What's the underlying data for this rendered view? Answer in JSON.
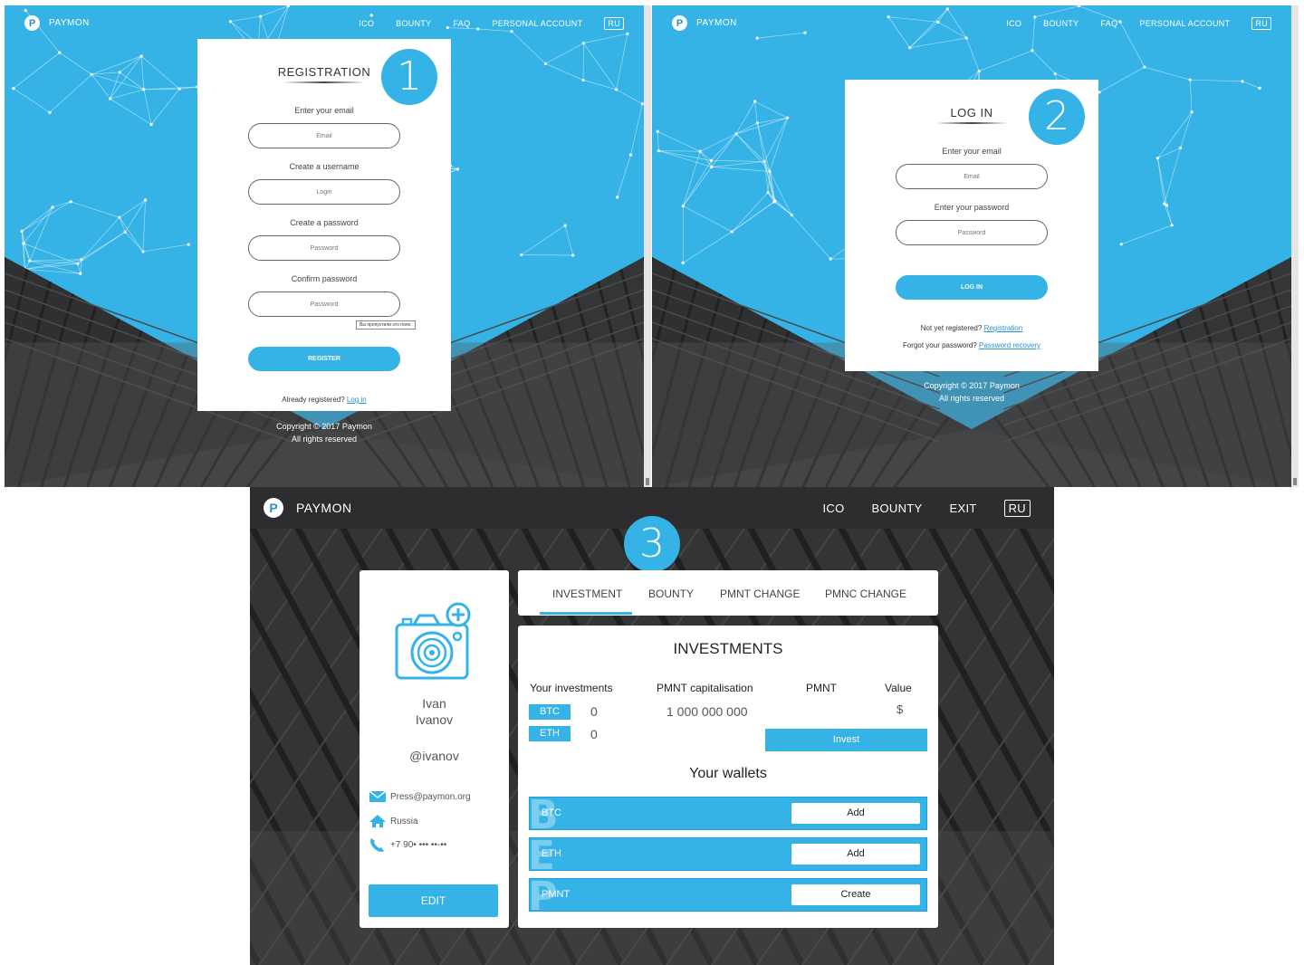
{
  "colors": {
    "accent": "#35b3e6",
    "dark": "#2d2d2f",
    "link": "#2b91d6"
  },
  "nav": {
    "brand": "PAYMON",
    "ico": "ICO",
    "bounty": "BOUNTY",
    "faq": "FAQ",
    "personal_account": "PERSONAL ACCOUNT",
    "lang": "RU",
    "exit": "EXIT"
  },
  "registration": {
    "step": "1",
    "title": "REGISTRATION",
    "email_label": "Enter your email",
    "email_placeholder": "Email",
    "username_label": "Create a username",
    "username_placeholder": "Login",
    "password_label": "Create a password",
    "password_placeholder": "Password",
    "confirm_label": "Confirm password",
    "confirm_placeholder": "Password",
    "tooltip": "Вы пропустили это поле.",
    "register_button": "REGISTER",
    "already_text": "Already registered?",
    "login_link": "Log in"
  },
  "login": {
    "step": "2",
    "title": "LOG IN",
    "email_label": "Enter your email",
    "email_placeholder": "Email",
    "password_label": "Enter your password",
    "password_placeholder": "Password",
    "login_button": "LOG IN",
    "not_registered": "Not yet registered?",
    "registration_link": "Registration",
    "forgot": "Forgot your password?",
    "recovery_link": "Password recovery"
  },
  "copyright": {
    "line1": "Copyright © 2017 Paymon",
    "line2": "All rights reserved"
  },
  "account": {
    "step": "3",
    "profile": {
      "first_name": "Ivan",
      "last_name": "Ivanov",
      "handle": "@ivanov",
      "email": "Press@paymon.org",
      "country": "Russia",
      "phone": "+7 90• ••• ••-••",
      "edit_button": "EDIT",
      "icons": [
        "camera-plus-icon",
        "envelope-icon",
        "home-icon",
        "phone-icon"
      ]
    },
    "tabs": [
      "INVESTMENT",
      "BOUNTY",
      "PMNT CHANGE",
      "PMNC CHANGE"
    ],
    "active_tab": "INVESTMENT",
    "investments": {
      "title": "INVESTMENTS",
      "col_your": "Your investments",
      "col_cap": "PMNT capitalisation",
      "col_pmnt": "PMNT",
      "col_value": "Value",
      "btc_label": "BTC",
      "btc_amount": "0",
      "eth_label": "ETH",
      "eth_amount": "0",
      "capitalisation": "1 000 000 000",
      "value_currency": "$",
      "invest_button": "Invest"
    },
    "wallets": {
      "title": "Your wallets",
      "items": [
        {
          "name": "BTC",
          "glyph": "B",
          "action": "Add"
        },
        {
          "name": "ETH",
          "glyph": "E",
          "action": "Add"
        },
        {
          "name": "PMNT",
          "glyph": "P",
          "action": "Create"
        }
      ]
    }
  }
}
